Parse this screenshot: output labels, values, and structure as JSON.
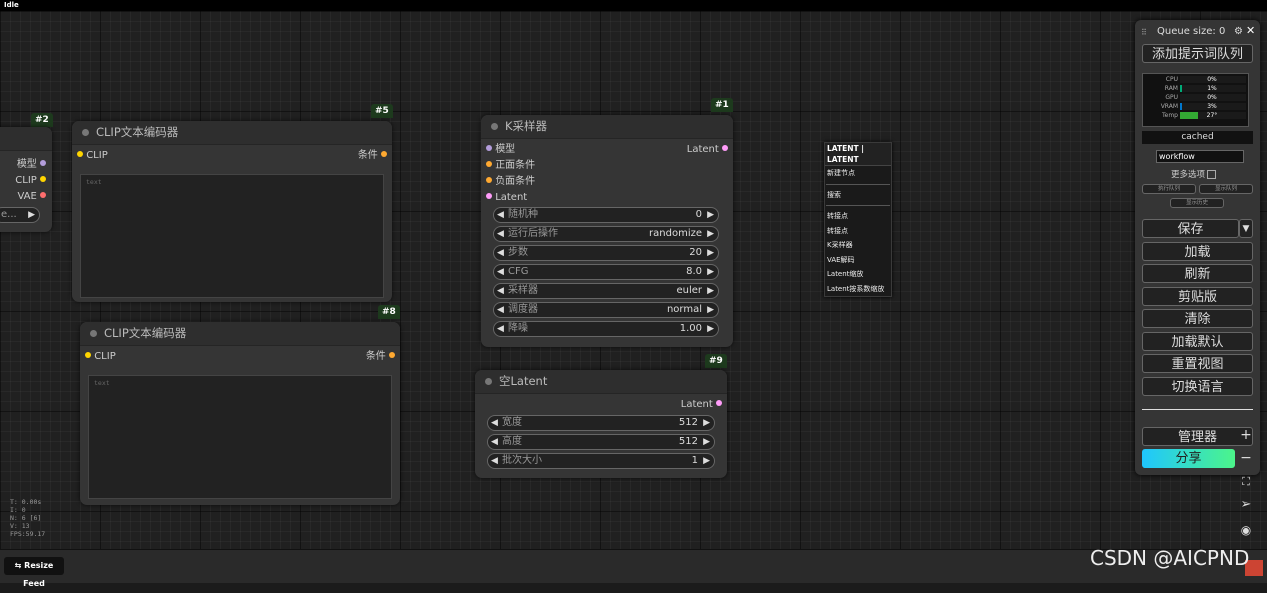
{
  "status": "Idle",
  "nodes": {
    "loader": {
      "badge": "#2",
      "outputs": [
        "模型",
        "CLIP",
        "VAE"
      ],
      "widget_value": "e..."
    },
    "clip5": {
      "badge": "#5",
      "title": "CLIP文本编码器",
      "input": "CLIP",
      "output": "条件",
      "text_placeholder": "text"
    },
    "clip8": {
      "badge": "#8",
      "title": "CLIP文本编码器",
      "input": "CLIP",
      "output": "条件",
      "text_placeholder": "text"
    },
    "ksampler": {
      "badge": "#1",
      "title": "K采样器",
      "inputs": [
        "模型",
        "正面条件",
        "负面条件",
        "Latent"
      ],
      "output": "Latent",
      "widgets": [
        {
          "label": "随机种",
          "value": "0"
        },
        {
          "label": "运行后操作",
          "value": "randomize"
        },
        {
          "label": "步数",
          "value": "20"
        },
        {
          "label": "CFG",
          "value": "8.0"
        },
        {
          "label": "采样器",
          "value": "euler"
        },
        {
          "label": "调度器",
          "value": "normal"
        },
        {
          "label": "降噪",
          "value": "1.00"
        }
      ]
    },
    "latent": {
      "badge": "#9",
      "title": "空Latent",
      "output": "Latent",
      "widgets": [
        {
          "label": "宽度",
          "value": "512"
        },
        {
          "label": "高度",
          "value": "512"
        },
        {
          "label": "批次大小",
          "value": "1"
        }
      ]
    }
  },
  "context_menu": {
    "header": "LATENT | LATENT",
    "group1": [
      "新建节点"
    ],
    "group2": [
      "搜索"
    ],
    "group3": [
      "转接点",
      "转接点",
      "K采样器",
      "VAE解码",
      "Latent缩放",
      "Latent按系数缩放"
    ]
  },
  "panel": {
    "queue_size": "Queue size: 0",
    "add_prompt_queue": "添加提示词队列",
    "monitor": [
      {
        "label": "CPU",
        "value": "0%",
        "fill": 0,
        "color": "#0a7"
      },
      {
        "label": "RAM",
        "value": "1%",
        "fill": 0.01,
        "color": "#0a7"
      },
      {
        "label": "GPU",
        "value": "0%",
        "fill": 0,
        "color": "#0a7"
      },
      {
        "label": "VRAM",
        "value": "3%",
        "fill": 0.03,
        "color": "#07c"
      },
      {
        "label": "Temp",
        "value": "27°",
        "fill": 0.27,
        "color": "#3a3"
      }
    ],
    "cached": "cached",
    "workflow_value": "workflow",
    "more_options": "更多选项",
    "exec_queue": "执行队列",
    "show_queue": "显示队列",
    "show_history": "显示历史",
    "save": "保存",
    "buttons": [
      "加载",
      "刷新",
      "剪贴版",
      "清除",
      "加载默认",
      "重置视图",
      "切换语言"
    ],
    "manager": "管理器",
    "share": "分享"
  },
  "stats": [
    "T: 0.00s",
    "I: 0",
    "N: 6 [6]",
    "V: 13",
    "FPS:59.17"
  ],
  "resize_feed": "Resize Feed",
  "watermark": "CSDN @AICPND",
  "colors": {
    "model_slot": "#b39ddb",
    "clip_slot": "#ffd500",
    "vae_slot": "#ff6e6e",
    "cond_slot": "#ffa931",
    "latent_slot": "#ff9cf9",
    "share_gradient_start": "#1fc6ff",
    "share_gradient_end": "#4cf58a"
  }
}
